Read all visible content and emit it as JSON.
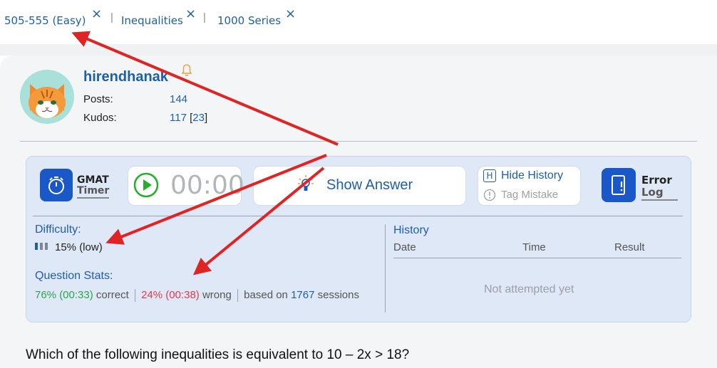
{
  "tags": [
    {
      "label": "505-555 (Easy)"
    },
    {
      "label": "Inequalities"
    },
    {
      "label": "1000 Series"
    }
  ],
  "tag_remove_glyph": "×",
  "tag_separator": "|",
  "user": {
    "name": "hirendhanak",
    "posts_label": "Posts:",
    "posts_value": "144",
    "kudos_label": "Kudos:",
    "kudos_value": "117",
    "kudos_extra_open": "[",
    "kudos_extra": "23",
    "kudos_extra_close": "]"
  },
  "timer": {
    "label_top": "GMAT",
    "label_bottom": "Timer",
    "display": "00:00"
  },
  "show_answer": "Show Answer",
  "history_controls": {
    "hide_key": "H",
    "hide_label": "Hide History",
    "tag_mistake_label": "Tag Mistake"
  },
  "error_log": {
    "label_top": "Error",
    "label_bottom": "Log"
  },
  "difficulty": {
    "label": "Difficulty:",
    "value": "15% (low)"
  },
  "question_stats": {
    "label": "Question Stats:",
    "correct_pct": "76% (00:33)",
    "correct_word": "correct",
    "wrong_pct": "24% (00:38)",
    "wrong_word": "wrong",
    "based_on": "based on",
    "sessions_count": "1767",
    "sessions_word": "sessions"
  },
  "history": {
    "title": "History",
    "columns": [
      "Date",
      "Time",
      "Result"
    ],
    "empty": "Not attempted yet"
  },
  "question": "Which of the following inequalities is equivalent to 10 – 2x > 18?",
  "colors": {
    "link_blue": "#1f5fa8",
    "brand_blue": "#1a57c8",
    "correct_green": "#2da44e",
    "wrong_red": "#e0394a",
    "play_green": "#22b02a",
    "bell_orange": "#f0a23b",
    "annotation_red": "#e02424"
  }
}
